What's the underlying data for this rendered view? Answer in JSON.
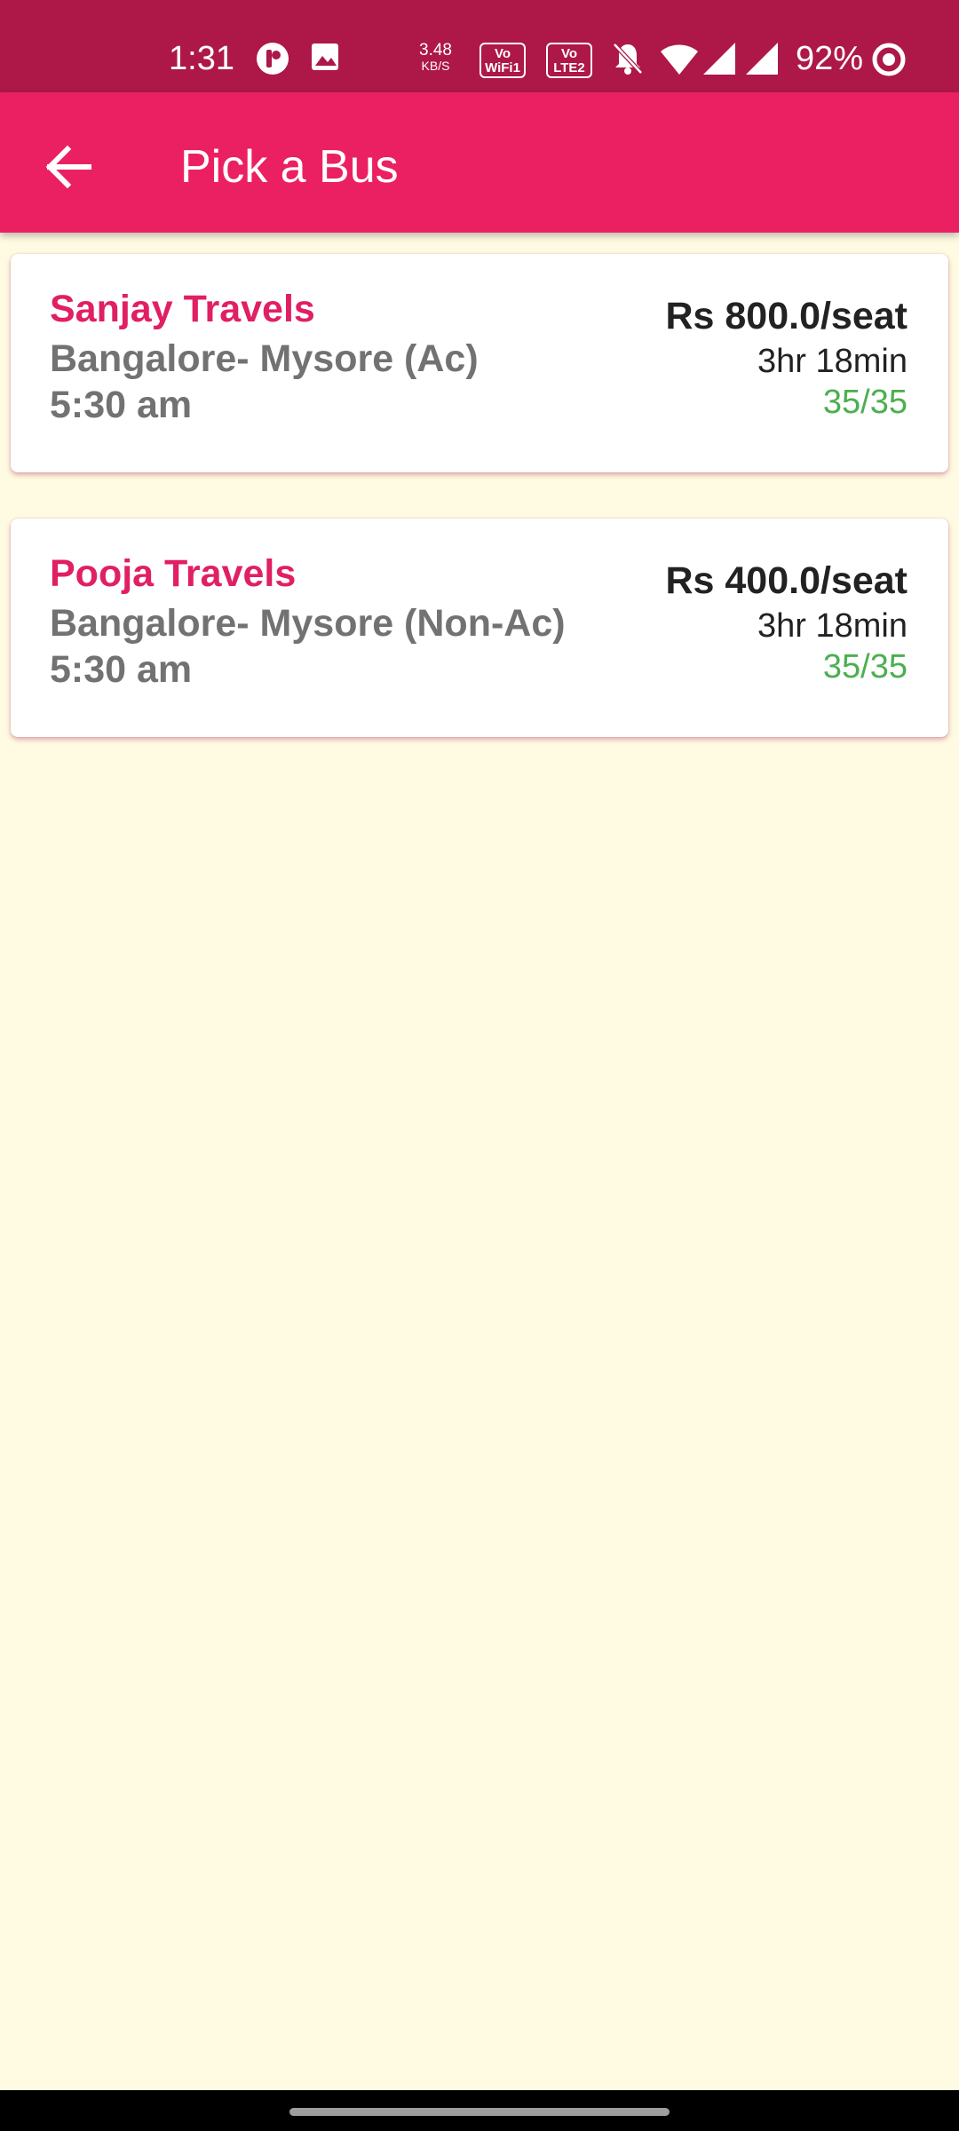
{
  "status_bar": {
    "time": "1:31",
    "net_speed": "3.48",
    "net_speed_unit": "KB/S",
    "sim1_top": "Vo",
    "sim1_bottom": "WiFi1",
    "sim2_top": "Vo",
    "sim2_bottom": "LTE2",
    "battery": "92%",
    "icons": [
      "notification-app-icon",
      "gallery-icon",
      "bell-off-icon",
      "wifi-icon",
      "signal-icon",
      "signal-icon",
      "battery-ring-icon"
    ]
  },
  "app_bar": {
    "title": "Pick a Bus",
    "back_icon": "arrow-back-icon",
    "background": "#eb2062"
  },
  "buses": [
    {
      "operator": "Sanjay Travels",
      "route": "Bangalore- Mysore (Ac)",
      "departure": "5:30 am",
      "price": "Rs 800.0/seat",
      "duration": "3hr 18min",
      "seats": "35/35"
    },
    {
      "operator": "Pooja Travels",
      "route": "Bangalore- Mysore (Non-Ac)",
      "departure": "5:30 am",
      "price": "Rs 400.0/seat",
      "duration": "3hr 18min",
      "seats": "35/35"
    }
  ],
  "colors": {
    "status_bar": "#ad1849",
    "accent": "#e01f64",
    "background": "#fffbe3",
    "seats": "#4caf50"
  }
}
